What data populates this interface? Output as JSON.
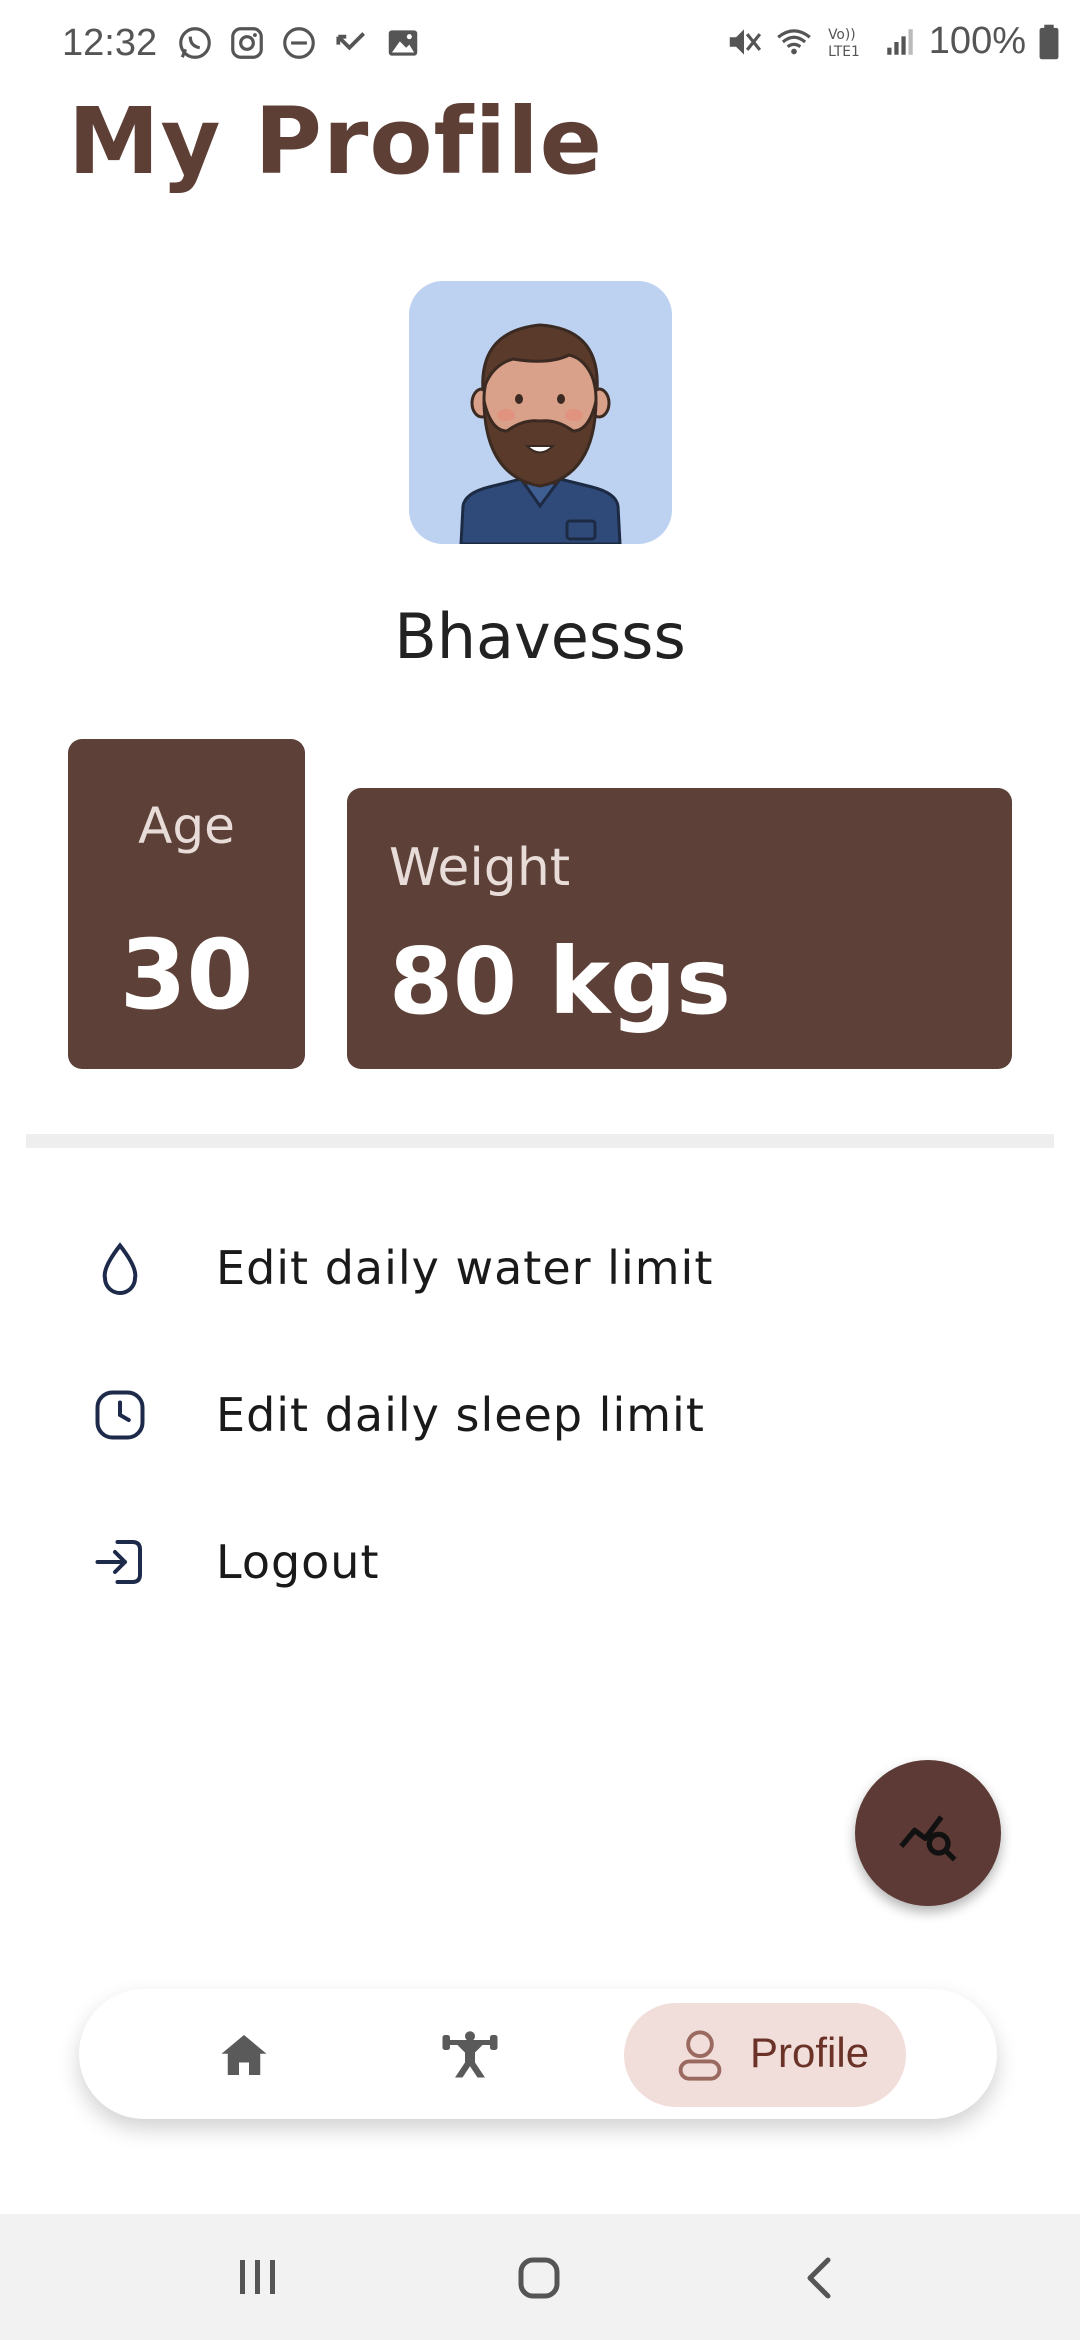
{
  "status_bar": {
    "time": "12:32",
    "battery": "100%",
    "left_icons": [
      "whatsapp-icon",
      "instagram-icon",
      "dnd-icon",
      "missed-call-icon",
      "gallery-icon"
    ],
    "right_icons": [
      "mute-icon",
      "wifi-icon",
      "volte-icon",
      "signal-icon",
      "battery-icon"
    ]
  },
  "header": {
    "title": "My Profile"
  },
  "profile": {
    "name": "Bhavesss",
    "avatar": "bearded-man-avatar"
  },
  "stats": {
    "age": {
      "label": "Age",
      "value": "30"
    },
    "weight": {
      "label": "Weight",
      "value": "80 kgs"
    }
  },
  "menu": {
    "items": [
      {
        "label": "Edit daily water limit",
        "icon": "water-drop-icon"
      },
      {
        "label": "Edit daily sleep limit",
        "icon": "clock-icon"
      },
      {
        "label": "Logout",
        "icon": "logout-icon"
      }
    ]
  },
  "fab": {
    "icon": "chart-search-icon"
  },
  "bottom_nav": {
    "items": [
      {
        "icon": "home-icon",
        "selected": false
      },
      {
        "icon": "fitness-icon",
        "selected": false
      },
      {
        "icon": "person-icon",
        "label": "Profile",
        "selected": true
      }
    ]
  },
  "colors": {
    "brand": "#5d4037",
    "title": "#5d3f36",
    "avatar_bg": "#bdd1f0",
    "nav_selected_bg": "#f1dedb",
    "nav_selected_text": "#6b3228"
  }
}
